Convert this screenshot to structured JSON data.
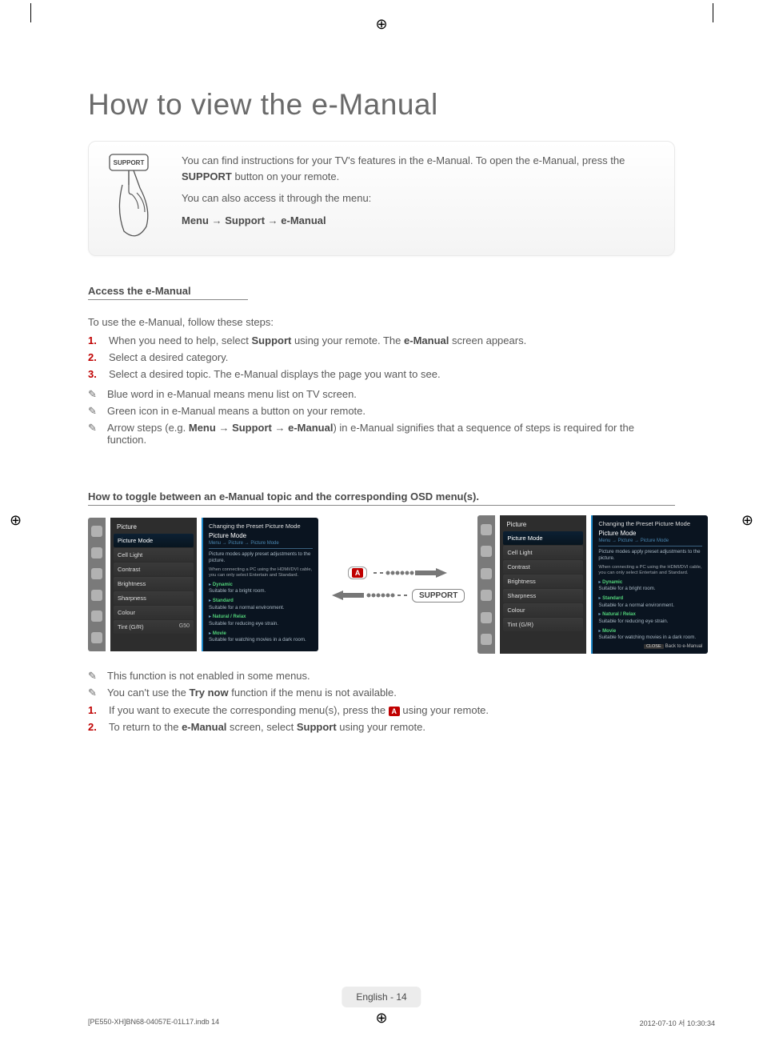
{
  "reg_glyph": "⊕",
  "title": "How to view the e-Manual",
  "intro": {
    "p1_a": "You can find instructions for your TV's features in the e-Manual. To open the e-Manual, press the ",
    "p1_bold": "SUPPORT",
    "p1_b": " button on your remote.",
    "p2": "You can also access it through the menu:",
    "path_a": "Menu",
    "path_b": "Support",
    "path_c": "e-Manual",
    "support_btn": "SUPPORT"
  },
  "sec1": {
    "heading": "Access the e-Manual",
    "lead": "To use the e-Manual, follow these steps:",
    "steps": [
      {
        "num": "1.",
        "a": "When you need to help, select ",
        "b1": "Support",
        "mid": " using your remote. The ",
        "b2": "e-Manual",
        "c": " screen appears."
      },
      {
        "num": "2.",
        "a": "Select a desired category."
      },
      {
        "num": "3.",
        "a": "Select a desired topic. The e-Manual displays the page you want to see."
      }
    ],
    "notes": [
      "Blue word in e-Manual means menu list on TV screen.",
      "Green icon in e-Manual means a button on your remote."
    ],
    "note_arrow": {
      "pre": "Arrow steps (e.g. ",
      "a": "Menu",
      "b": "Support",
      "c": "e-Manual",
      "post": ") in e-Manual signifies that a sequence of steps is required for the function."
    },
    "note_icon": "✎"
  },
  "sec2": {
    "heading": "How to toggle between an e-Manual topic and the corresponding OSD menu(s).",
    "osd": {
      "panel_title": "Changing the Preset Picture Mode",
      "menu_header": "Picture",
      "menu_items": [
        {
          "label": "Picture Mode",
          "val": ""
        },
        {
          "label": "Cell Light",
          "val": ""
        },
        {
          "label": "Contrast",
          "val": ""
        },
        {
          "label": "Brightness",
          "val": ""
        },
        {
          "label": "Sharpness",
          "val": ""
        },
        {
          "label": "Colour",
          "val": ""
        },
        {
          "label": "Tint (G/R)",
          "val": "G50"
        }
      ],
      "detail_title": "Picture Mode",
      "detail_path": "Menu → Picture → Picture Mode",
      "detail_descr": "Picture modes apply preset adjustments to the picture.",
      "detail_note": "When connecting a PC using the HDMI/DVI cable, you can only select Entertain and Standard.",
      "detail_items": [
        {
          "name": "Dynamic",
          "desc": "Suitable for a bright room."
        },
        {
          "name": "Standard",
          "desc": "Suitable for a normal environment."
        },
        {
          "name": "Natural / Relax",
          "desc": "Suitable for reducing eye strain."
        },
        {
          "name": "Movie",
          "desc": "Suitable for watching movies in a dark room."
        }
      ],
      "detail_footer_close": "CLOSE",
      "detail_footer_label": "Back to e-Manual",
      "key_a": "A",
      "key_support": "SUPPORT"
    },
    "after_notes": [
      "This function is not enabled in some menus.",
      {
        "a": "You can't use the ",
        "b": "Try now",
        "c": " function if the menu is not available."
      }
    ],
    "after_steps": [
      {
        "num": "1.",
        "a": "If you want to execute the corresponding menu(s), press the ",
        "key": "A",
        "c": " using your remote."
      },
      {
        "num": "2.",
        "a": "To return to the ",
        "b1": "e-Manual",
        "mid": " screen, select ",
        "b2": "Support",
        "c": " using your remote."
      }
    ]
  },
  "footer": {
    "page_label": "English - 14",
    "imprint_left": "[PE550-XH]BN68-04057E-01L17.indb   14",
    "imprint_right": "2012-07-10   서 10:30:34"
  }
}
